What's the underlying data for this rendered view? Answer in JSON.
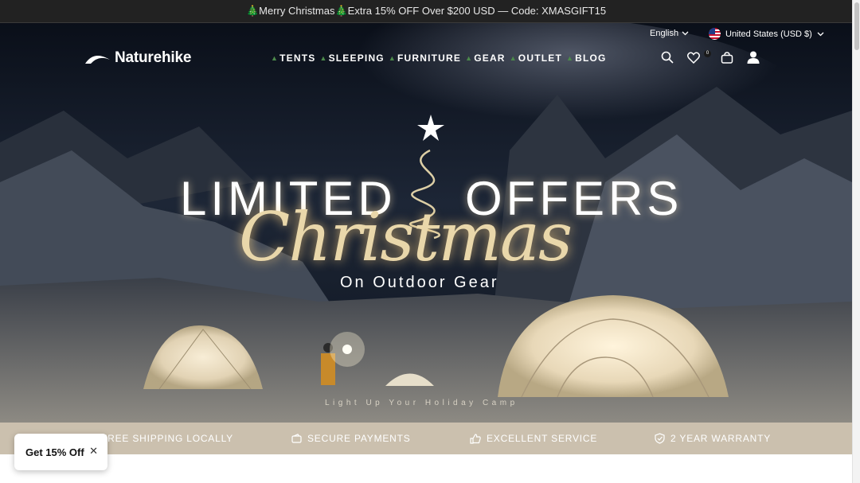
{
  "announcement": "🎄Merry Christmas🎄Extra 15% OFF Over $200 USD — Code: XMASGIFT15",
  "topbar": {
    "language": "English",
    "country": "United States (USD $)"
  },
  "brand": {
    "name": "Naturehike"
  },
  "nav": [
    "TENTS",
    "SLEEPING",
    "FURNITURE",
    "GEAR",
    "OUTLET",
    "BLOG"
  ],
  "header_icons": [
    "search-icon",
    "heart-icon",
    "bag-icon",
    "account-icon"
  ],
  "wishlist_count": "0",
  "hero": {
    "title_left": "LIMITED",
    "title_right": "OFFERS",
    "script": "Christmas",
    "subtitle": "On Outdoor Gear",
    "tagline": "Light Up Your Holiday Camp"
  },
  "trust": [
    {
      "icon": "truck-icon",
      "label": "FREE SHIPPING LOCALLY"
    },
    {
      "icon": "wallet-icon",
      "label": "SECURE PAYMENTS"
    },
    {
      "icon": "thumbs-up-icon",
      "label": "EXCELLENT SERVICE"
    },
    {
      "icon": "shield-check-icon",
      "label": "2 YEAR WARRANTY"
    }
  ],
  "popup": {
    "label": "Get 15% Off",
    "close": "✕"
  },
  "colors": {
    "announce_bg": "#222222",
    "trust_bg": "#cbc0ae",
    "glow": "#e9d7aa"
  }
}
